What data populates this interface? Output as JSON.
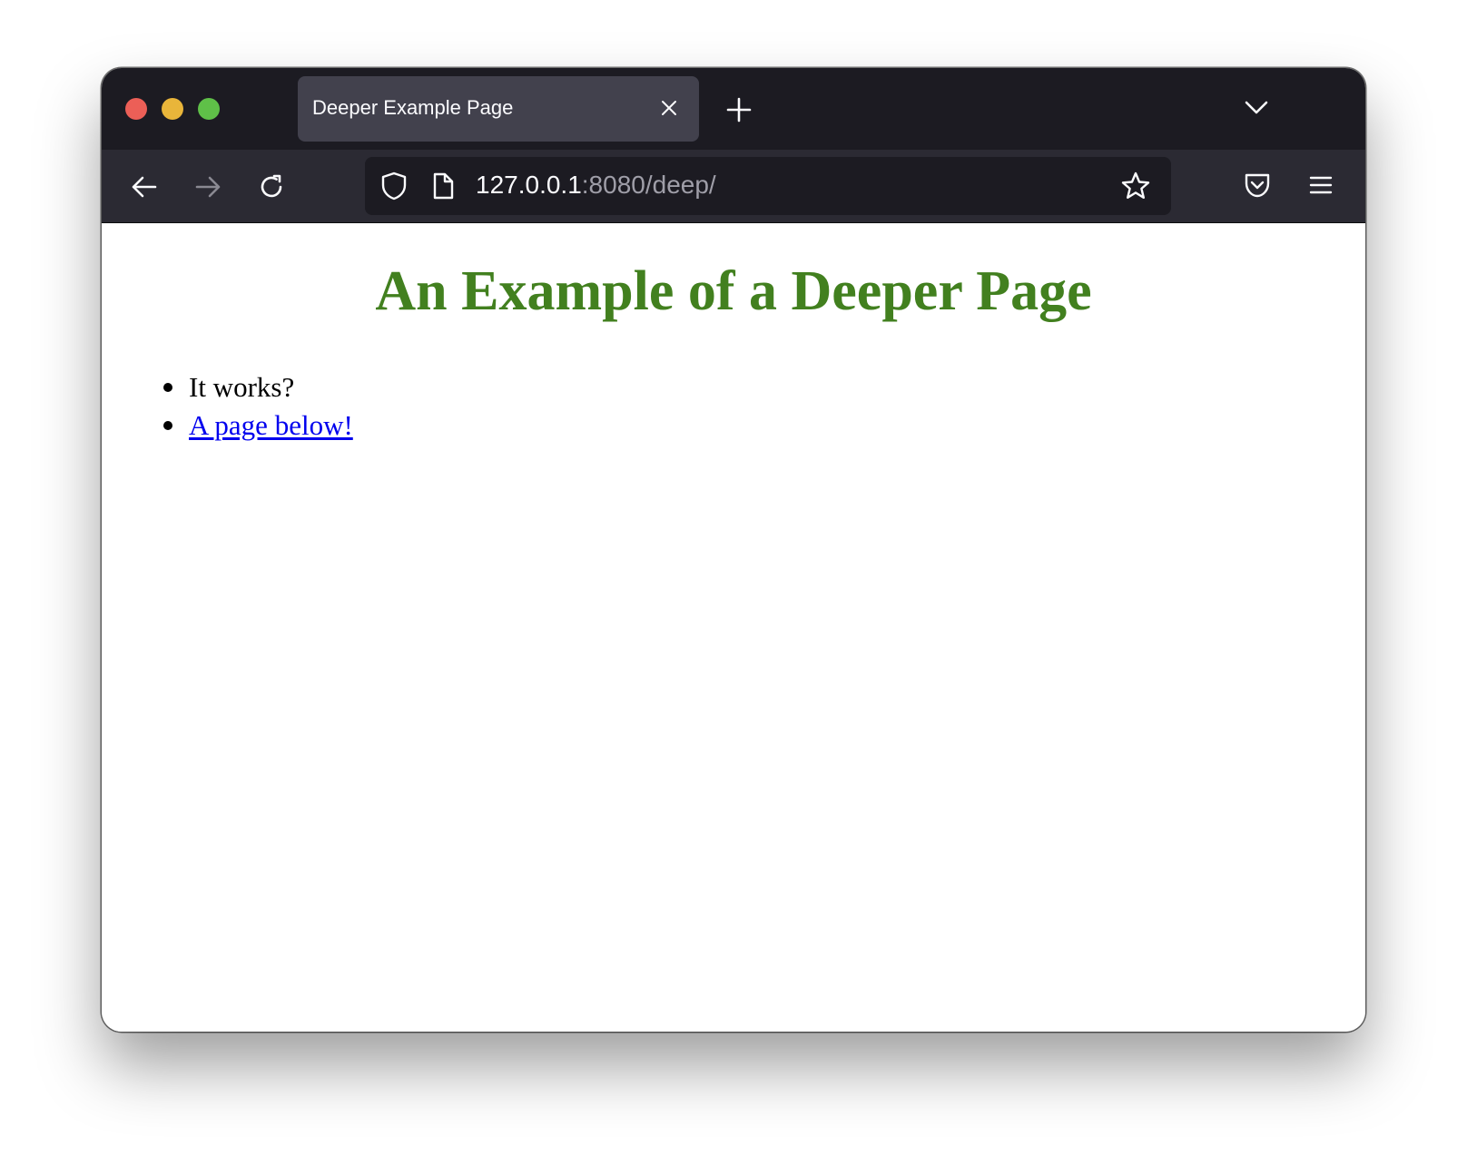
{
  "window": {
    "traffic_lights": {
      "close_color": "#ec5f57",
      "minimize_color": "#e9b53a",
      "maximize_color": "#5fc048"
    }
  },
  "tab": {
    "title": "Deeper Example Page",
    "close_icon": "close-icon",
    "new_tab_icon": "plus-icon",
    "list_all_tabs_icon": "chevron-down-icon"
  },
  "toolbar": {
    "back_icon": "back-arrow-icon",
    "forward_icon": "forward-arrow-icon",
    "forward_enabled": false,
    "reload_icon": "reload-icon",
    "pocket_icon": "pocket-icon",
    "menu_icon": "hamburger-menu-icon"
  },
  "url": {
    "host": "127.0.0.1",
    "rest": ":8080/deep/",
    "tracking_icon": "shield-icon",
    "page_icon": "page-icon",
    "bookmark_icon": "star-icon"
  },
  "page": {
    "heading": "An Example of a Deeper Page",
    "heading_color": "#42801f",
    "items": [
      {
        "text": "It works?",
        "is_link": false
      },
      {
        "text": "A page below!",
        "is_link": true,
        "link_color": "#0000ee"
      }
    ]
  }
}
